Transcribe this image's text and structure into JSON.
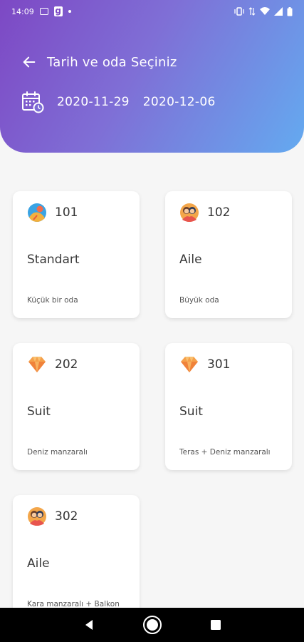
{
  "status_bar": {
    "time": "14:09",
    "g_label": "g"
  },
  "header": {
    "title": "Tarih ve oda Seçiniz",
    "start_date": "2020-11-29",
    "end_date": "2020-12-06"
  },
  "rooms": [
    {
      "number": "101",
      "type": "Standart",
      "description": "Küçük bir oda",
      "icon": "person-icon"
    },
    {
      "number": "102",
      "type": "Aile",
      "description": "Büyük oda",
      "icon": "family-icon"
    },
    {
      "number": "202",
      "type": "Suit",
      "description": "Deniz manzaralı",
      "icon": "diamond-icon"
    },
    {
      "number": "301",
      "type": "Suit",
      "description": "Teras + Deniz manzaralı",
      "icon": "diamond-icon"
    },
    {
      "number": "302",
      "type": "Aile",
      "description": "Kara manzaralı + Balkon",
      "icon": "family-icon"
    }
  ],
  "colors": {
    "gradient_start": "#7d48c4",
    "gradient_end": "#64aaf0",
    "background": "#f6f6f6"
  }
}
